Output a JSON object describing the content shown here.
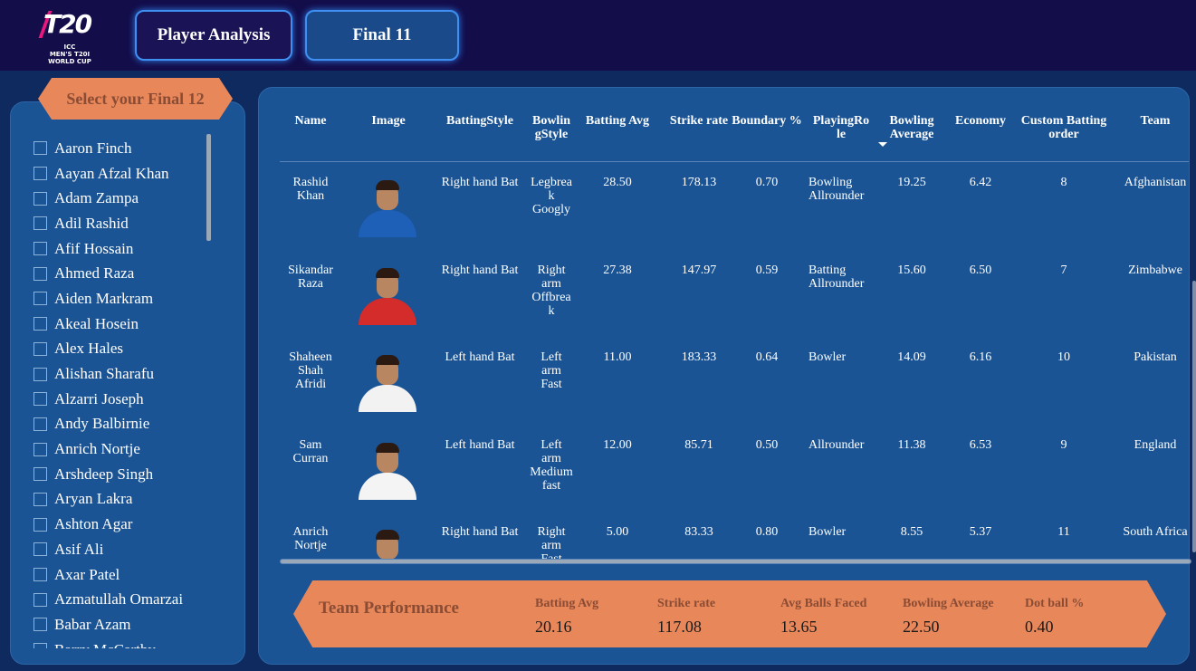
{
  "header": {
    "logo_lines": [
      "T20",
      "ICC",
      "MEN'S T20I",
      "WORLD CUP"
    ],
    "nav": [
      {
        "label": "Player Analysis"
      },
      {
        "label": "Final 11"
      }
    ]
  },
  "selector": {
    "title": "Select your Final 12",
    "players": [
      "Aaron Finch",
      "Aayan Afzal Khan",
      "Adam Zampa",
      "Adil Rashid",
      "Afif Hossain",
      "Ahmed Raza",
      "Aiden Markram",
      "Akeal Hosein",
      "Alex Hales",
      "Alishan Sharafu",
      "Alzarri Joseph",
      "Andy Balbirnie",
      "Anrich Nortje",
      "Arshdeep Singh",
      "Aryan Lakra",
      "Ashton Agar",
      "Asif Ali",
      "Axar Patel",
      "Azmatullah Omarzai",
      "Babar Azam",
      "Barry McCarthy"
    ]
  },
  "table": {
    "columns": [
      "Name",
      "Image",
      "BattingStyle",
      "Bowlin\ngStyle",
      "Batting Avg",
      "Strike rate",
      "Boundary %",
      "PlayingRo\nle",
      "Bowling\nAverage",
      "Economy",
      "Custom Batting\norder",
      "Team"
    ],
    "sorted_column": "Bowling Average",
    "sort_direction": "descending",
    "rows": [
      {
        "name": "Rashid\nKhan",
        "batting_style": "Right hand Bat",
        "bowling_style": "Legbrea\nk\nGoogly",
        "batting_avg": "28.50",
        "strike_rate": "178.13",
        "boundary": "0.70",
        "role": "Bowling\nAllrounder",
        "bowling_avg": "19.25",
        "economy": "6.42",
        "order": "8",
        "team": "Afghanistan",
        "jersey": "#1e5fb8"
      },
      {
        "name": "Sikandar\nRaza",
        "batting_style": "Right hand Bat",
        "bowling_style": "Right\narm\nOffbrea\nk",
        "batting_avg": "27.38",
        "strike_rate": "147.97",
        "boundary": "0.59",
        "role": "Batting\nAllrounder",
        "bowling_avg": "15.60",
        "economy": "6.50",
        "order": "7",
        "team": "Zimbabwe",
        "jersey": "#d42b2b"
      },
      {
        "name": "Shaheen\nShah\nAfridi",
        "batting_style": "Left hand Bat",
        "bowling_style": "Left\narm\nFast",
        "batting_avg": "11.00",
        "strike_rate": "183.33",
        "boundary": "0.64",
        "role": "Bowler",
        "bowling_avg": "14.09",
        "economy": "6.16",
        "order": "10",
        "team": "Pakistan",
        "jersey": "#f2f2f2"
      },
      {
        "name": "Sam\nCurran",
        "batting_style": "Left hand Bat",
        "bowling_style": "Left\narm\nMedium\nfast",
        "batting_avg": "12.00",
        "strike_rate": "85.71",
        "boundary": "0.50",
        "role": "Allrounder",
        "bowling_avg": "11.38",
        "economy": "6.53",
        "order": "9",
        "team": "England",
        "jersey": "#f4f4f4"
      },
      {
        "name": "Anrich\nNortje",
        "batting_style": "Right hand Bat",
        "bowling_style": "Right\narm\nFast",
        "batting_avg": "5.00",
        "strike_rate": "83.33",
        "boundary": "0.80",
        "role": "Bowler",
        "bowling_avg": "8.55",
        "economy": "5.37",
        "order": "11",
        "team": "South Africa",
        "jersey": "#1a6b3a"
      }
    ]
  },
  "team_performance": {
    "title": "Team Performance",
    "metrics": [
      {
        "label": "Batting Avg",
        "value": "20.16"
      },
      {
        "label": "Strike rate",
        "value": "117.08"
      },
      {
        "label": "Avg Balls Faced",
        "value": "13.65"
      },
      {
        "label": "Bowling Average",
        "value": "22.50"
      },
      {
        "label": "Dot ball %",
        "value": "0.40"
      }
    ]
  },
  "colors": {
    "topbar": "#130d4a",
    "panel": "#1b5494",
    "accent_orange": "#e8875a",
    "accent_text": "#8a4c34",
    "nav_glow": "#3f8ff0"
  }
}
